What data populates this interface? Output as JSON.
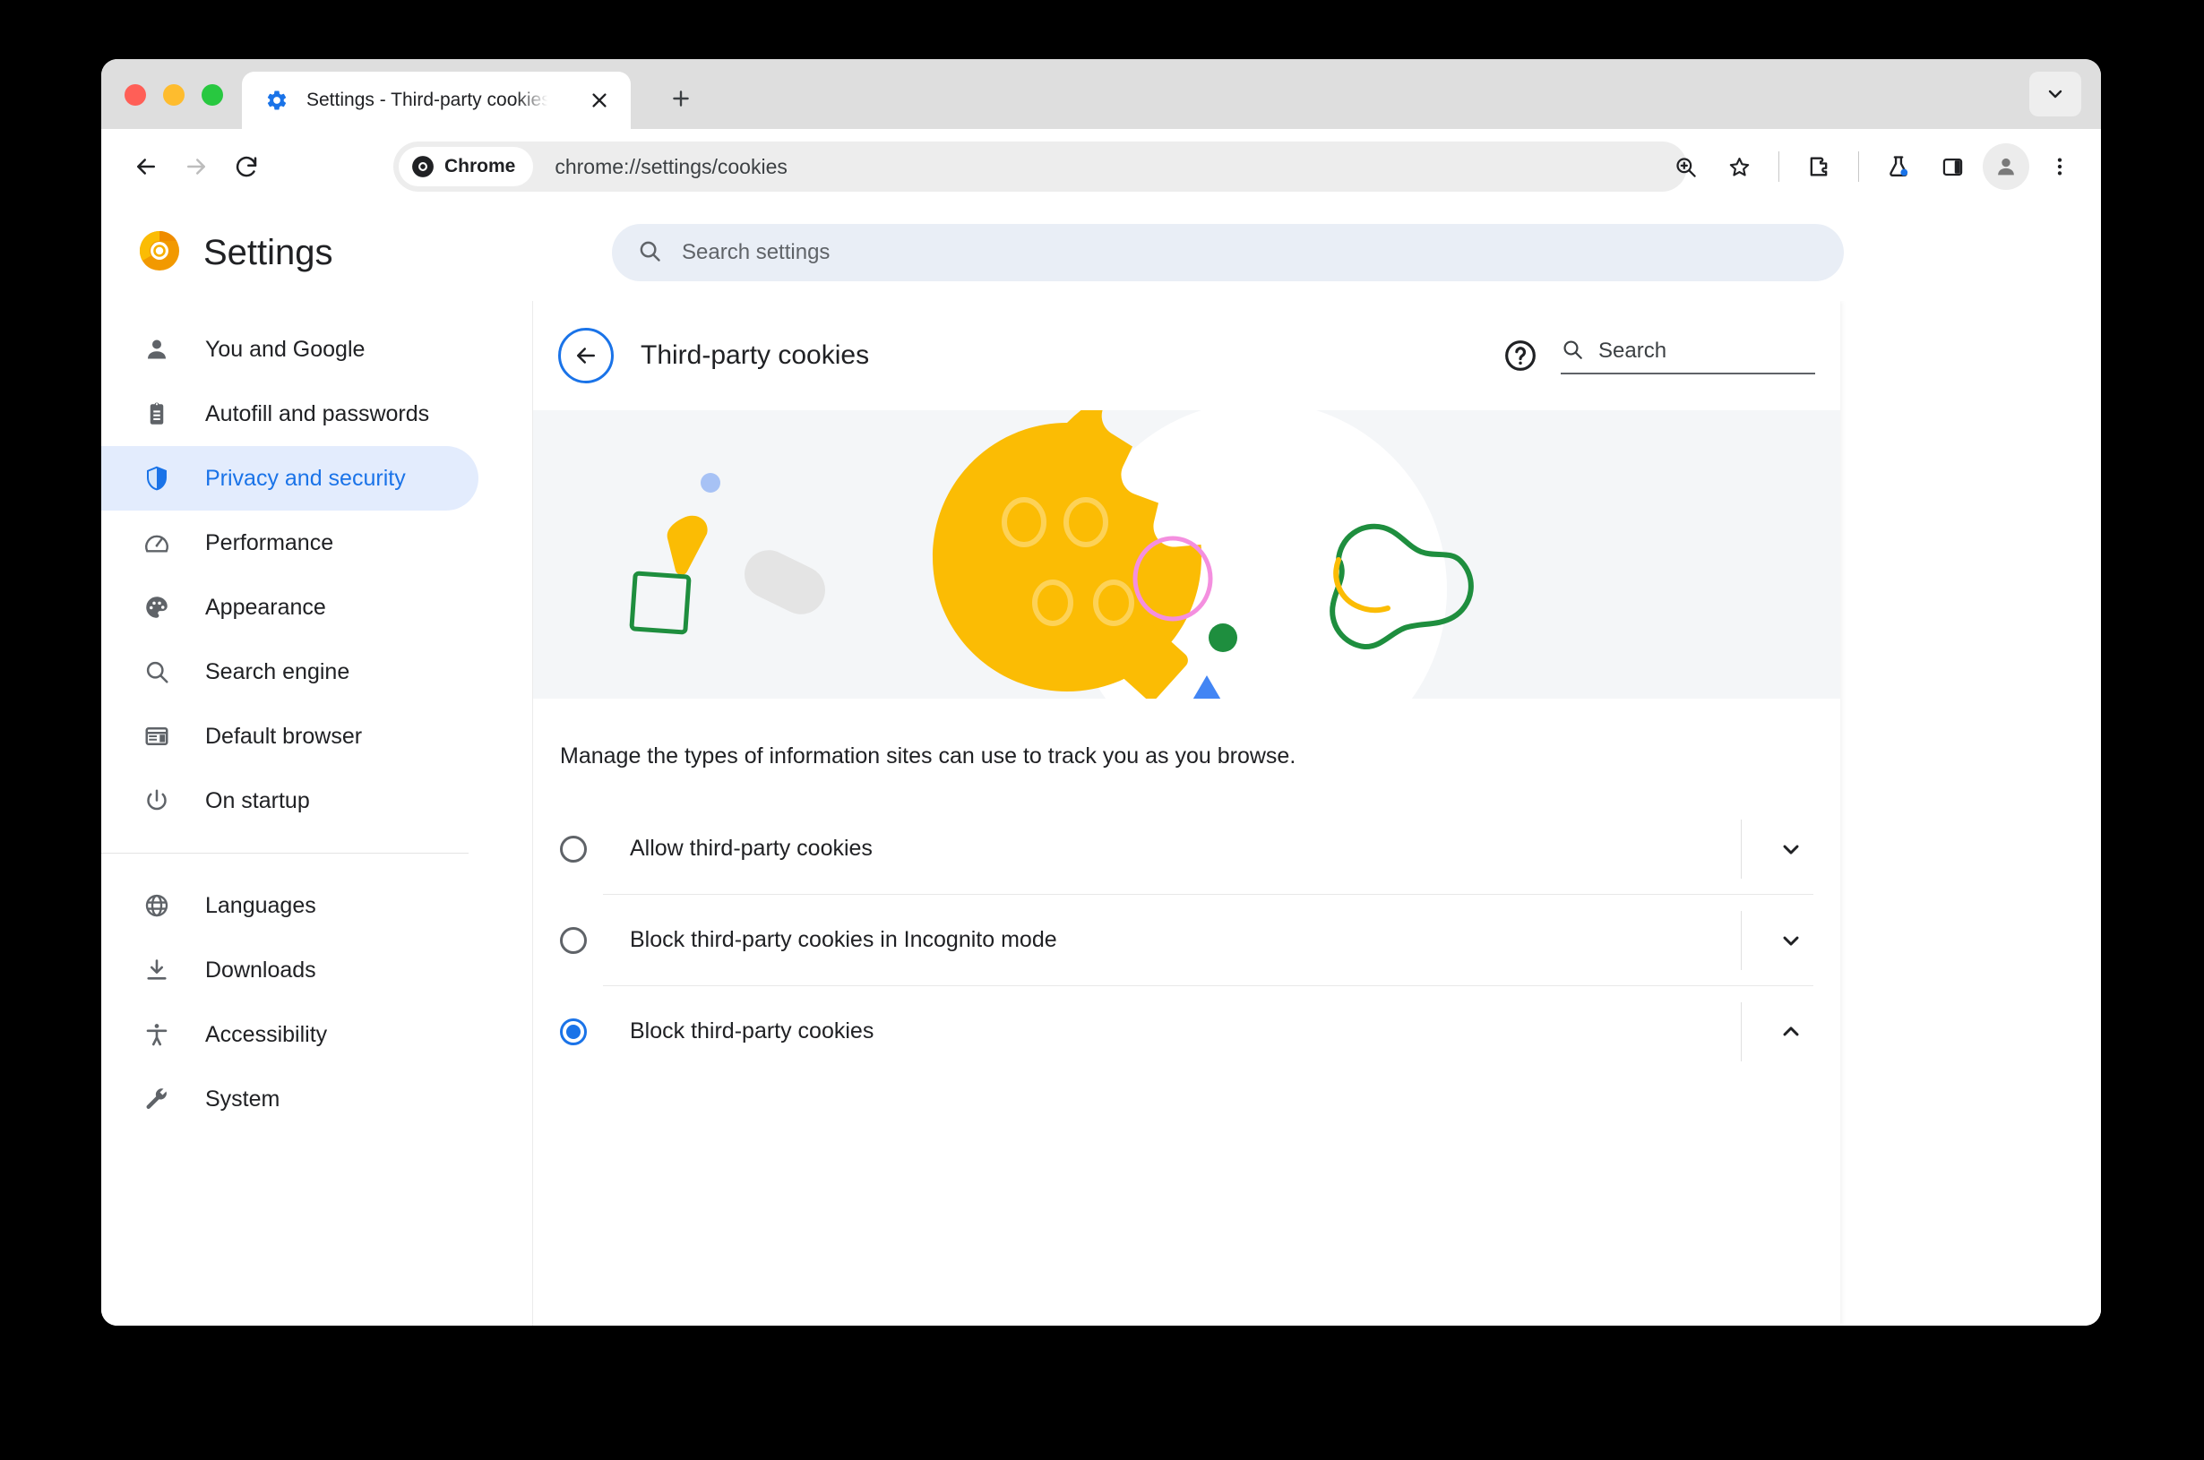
{
  "window": {
    "traffic_lights": [
      "close",
      "minimize",
      "maximize"
    ]
  },
  "tabstrip": {
    "tab_title": "Settings - Third-party cookies",
    "favicon": "gear-icon",
    "close_label": "×",
    "new_tab_label": "+",
    "tab_list_label": "⌄"
  },
  "toolbar": {
    "back_label": "←",
    "forward_label": "→",
    "reload_label": "↻",
    "chrome_chip_label": "Chrome",
    "url": "chrome://settings/cookies",
    "icons": [
      "zoom-icon",
      "bookmark-star-icon",
      "extensions-icon",
      "flask-icon",
      "side-panel-icon",
      "profile-icon",
      "more-menu-icon"
    ]
  },
  "settings_header": {
    "brand_title": "Settings",
    "search_placeholder": "Search settings"
  },
  "sidebar": {
    "items": [
      {
        "label": "You and Google",
        "icon": "person-icon",
        "active": false
      },
      {
        "label": "Autofill and passwords",
        "icon": "clipboard-icon",
        "active": false
      },
      {
        "label": "Privacy and security",
        "icon": "shield-icon",
        "active": true
      },
      {
        "label": "Performance",
        "icon": "speedometer-icon",
        "active": false
      },
      {
        "label": "Appearance",
        "icon": "palette-icon",
        "active": false
      },
      {
        "label": "Search engine",
        "icon": "search-icon",
        "active": false
      },
      {
        "label": "Default browser",
        "icon": "browser-icon",
        "active": false
      },
      {
        "label": "On startup",
        "icon": "power-icon",
        "active": false
      }
    ],
    "items2": [
      {
        "label": "Languages",
        "icon": "globe-icon",
        "active": false
      },
      {
        "label": "Downloads",
        "icon": "download-icon",
        "active": false
      },
      {
        "label": "Accessibility",
        "icon": "accessibility-icon",
        "active": false
      },
      {
        "label": "System",
        "icon": "wrench-icon",
        "active": false
      }
    ]
  },
  "page": {
    "title": "Third-party cookies",
    "help_label": "?",
    "search_placeholder": "Search",
    "description": "Manage the types of information sites can use to track you as you browse.",
    "options": [
      {
        "label": "Allow third-party cookies",
        "selected": false,
        "expanded": false
      },
      {
        "label": "Block third-party cookies in Incognito mode",
        "selected": false,
        "expanded": false
      },
      {
        "label": "Block third-party cookies",
        "selected": true,
        "expanded": true
      }
    ]
  },
  "colors": {
    "accent_blue": "#1a73e8",
    "nav_active_bg": "#e3ecfd",
    "cookie_yellow": "#fbbc04",
    "banner_bg": "#f4f6f8",
    "green": "#1e8e3e",
    "pink": "#f48fdf",
    "blue_shape": "#4285f4",
    "grey_shape": "#e4e4e4"
  }
}
